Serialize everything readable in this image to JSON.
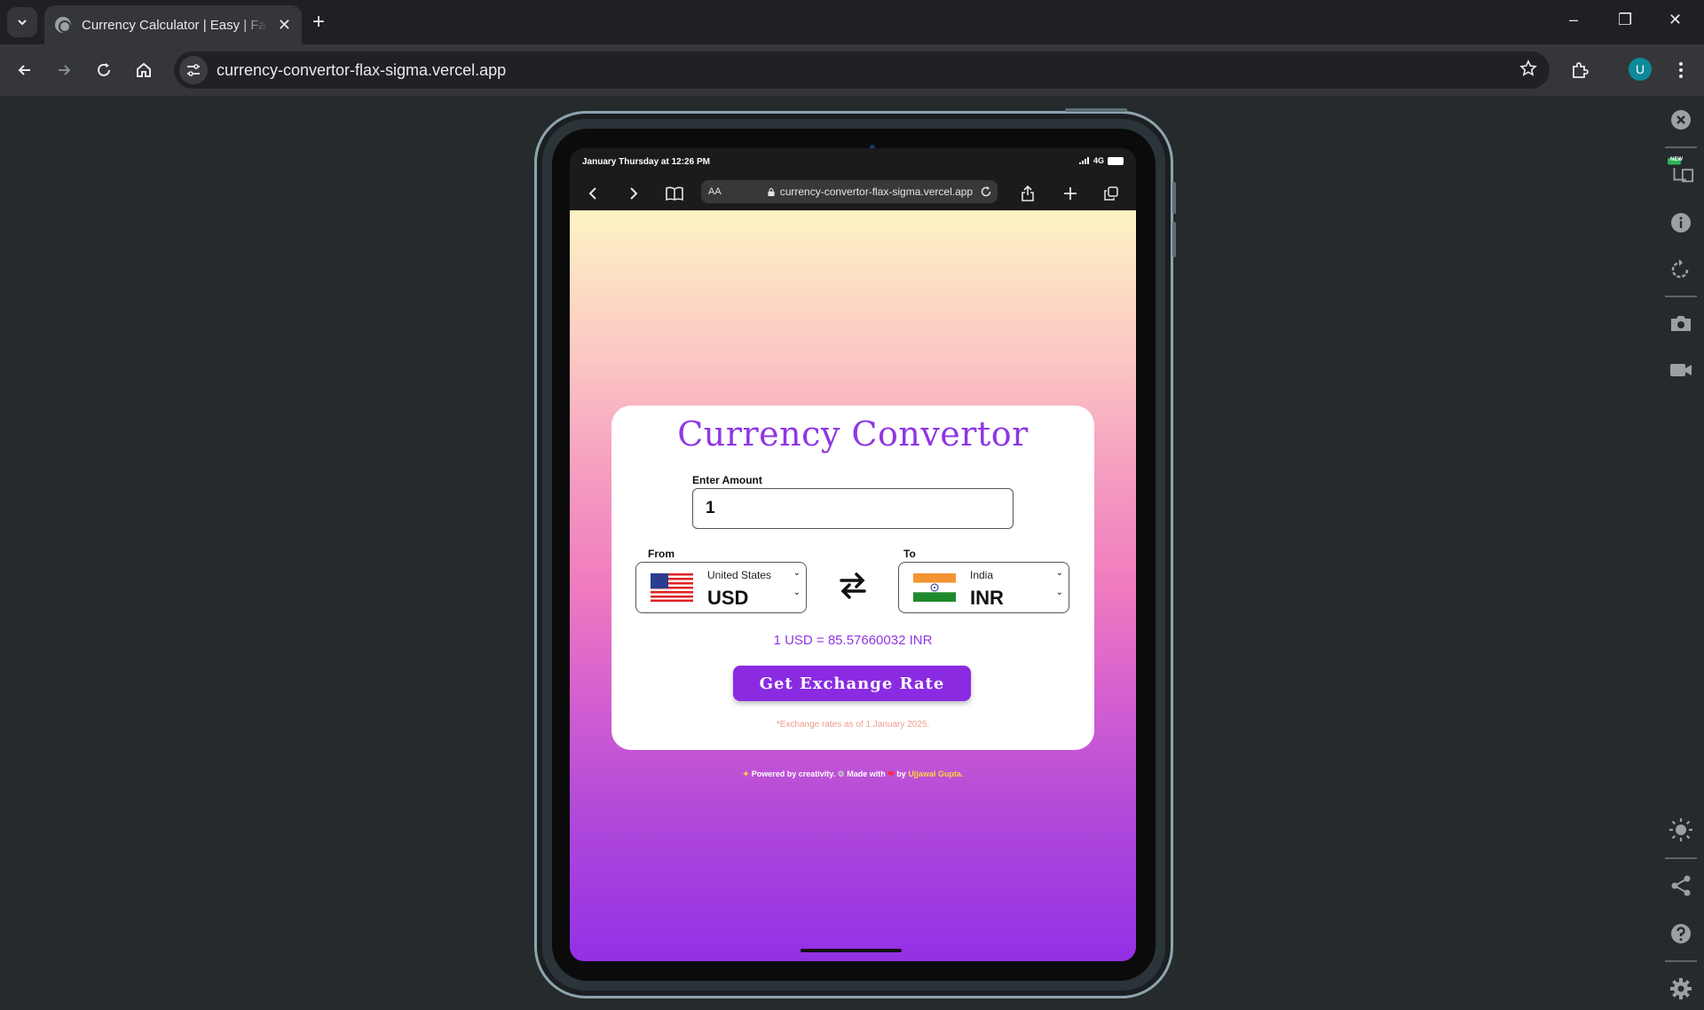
{
  "browser": {
    "tab_title": "Currency Calculator | Easy | Fast",
    "url": "currency-convertor-flax-sigma.vercel.app",
    "profile_initial": "U"
  },
  "device": {
    "status_time": "January Thursday at 12:26 PM",
    "network": "4G",
    "safari_aa": "AA",
    "safari_url": "currency-convertor-flax-sigma.vercel.app"
  },
  "app": {
    "title": "Currency Convertor",
    "amount_label": "Enter Amount",
    "amount_value": "1",
    "from_label": "From",
    "to_label": "To",
    "from_country": "United States",
    "from_code": "USD",
    "to_country": "India",
    "to_code": "INR",
    "rate_text": "1 USD = 85.57660032 INR",
    "button_label": "Get Exchange Rate",
    "note": "*Exchange rates as of 1 January 2025.",
    "footer_powered": "Powered by creativity.",
    "footer_made": "Made with",
    "footer_by": "by",
    "footer_name": "Ujjawal Gupta."
  },
  "side_panel": {
    "new_badge": "NEW"
  },
  "colors": {
    "accent": "#8a2be2",
    "title": "#8f36e3",
    "note": "#f29a8e",
    "footer_name": "#ffd23f"
  }
}
